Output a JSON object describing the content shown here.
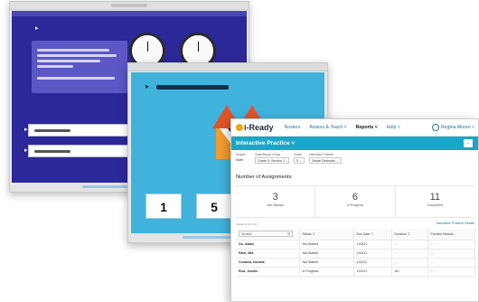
{
  "back_window": {
    "answers": [
      "",
      ""
    ]
  },
  "middle_window": {
    "numbers": [
      "1",
      "5"
    ]
  },
  "iready": {
    "logo": "i-Ready",
    "nav": {
      "items": [
        {
          "label": "Rosters"
        },
        {
          "label": "Assess & Teach ˅"
        },
        {
          "label": "Reports ˅",
          "active": true
        },
        {
          "label": "Help ˅"
        }
      ],
      "user": "Regina Moore ˅"
    },
    "banner": {
      "title": "Interactive Practice ˅",
      "menu_glyph": "⌄"
    },
    "filters": [
      {
        "label": "Subject",
        "value": "Math"
      },
      {
        "label": "Class/Report Group",
        "value": "Grade 5, Section 1 ⌄"
      },
      {
        "label": "Grade",
        "value": "5 ⌄"
      },
      {
        "label": "Interactive Practice",
        "value": "Divide Decimals ⌄"
      }
    ],
    "section_title": "Number of Assignments",
    "counts": [
      {
        "number": "3",
        "label": "Not Started"
      },
      {
        "number": "6",
        "label": "In Progress"
      },
      {
        "number": "11",
        "label": "Completed"
      }
    ],
    "showing": "Showing 10 of 20",
    "details_link": "Interactive Practice Details",
    "table": {
      "search_placeholder": "Student",
      "columns": [
        "Status",
        "Due Date",
        "Duration",
        "Practice Results"
      ],
      "rows": [
        {
          "student": "Go, Isaiah",
          "status": "Not Started",
          "due": "1/22/21",
          "duration": "--",
          "results": "--"
        },
        {
          "student": "Patel, Mia",
          "status": "Not Started",
          "due": "1/22/21",
          "duration": "--",
          "results": "--"
        },
        {
          "student": "Cordova, Daniela",
          "status": "Not Started",
          "due": "1/22/21",
          "duration": "--",
          "results": "--"
        },
        {
          "student": "Ruiz, Joselin",
          "status": "In Progress",
          "due": "1/22/21",
          "duration": "3m",
          "results": "--"
        }
      ]
    }
  }
}
